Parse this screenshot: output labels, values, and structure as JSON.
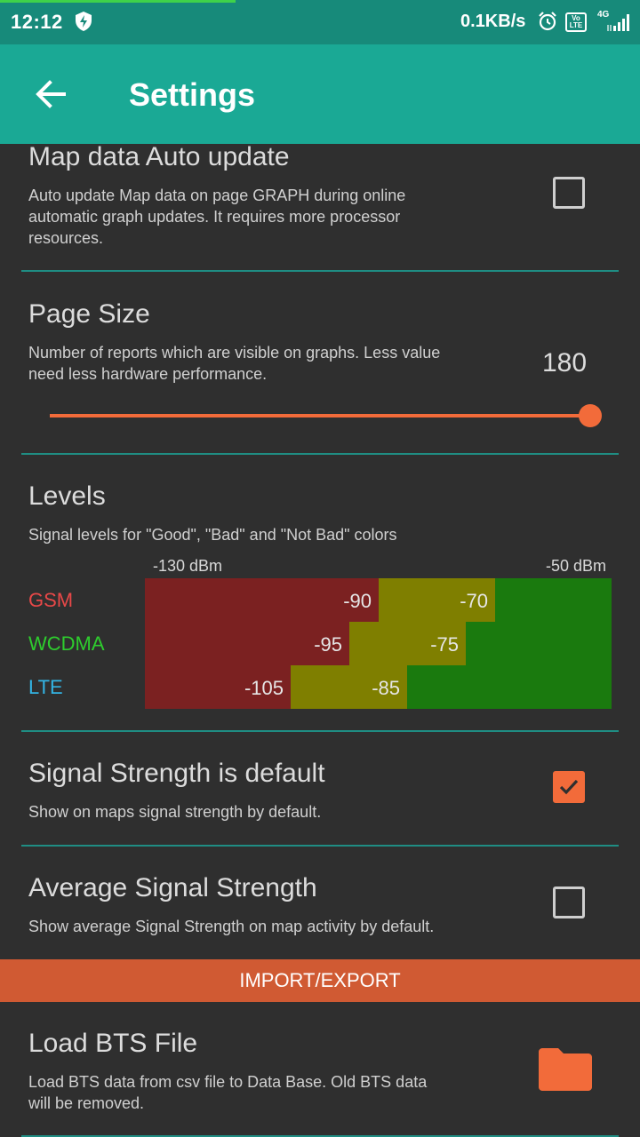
{
  "status_bar": {
    "time": "12:12",
    "net_speed": "0.1KB/s",
    "volte": "Vo LTE",
    "network_type": "4G",
    "icons": [
      "shield-icon",
      "alarm-icon",
      "volte-icon",
      "signal-icon"
    ]
  },
  "app_bar": {
    "title": "Settings",
    "back_icon": "arrow-left-icon"
  },
  "preferences": {
    "map_auto_update": {
      "title": "Map data Auto update",
      "summary_line1": "Auto update Map data on page GRAPH during online",
      "summary_line2": "automatic graph updates. It requires more processor",
      "summary_line3": "resources.",
      "checked": false
    },
    "page_size": {
      "title": "Page Size",
      "summary_line1": "Number of reports which are visible on graphs. Less value",
      "summary_line2": "need less hardware performance.",
      "value": "180",
      "slider_fraction": 1.0
    },
    "levels": {
      "title": "Levels",
      "summary": "Signal levels for \"Good\", \"Bad\" and \"Not Bad\" colors",
      "range_min": "-130 dBm",
      "range_max": "-50 dBm",
      "range_min_value": -130,
      "range_max_value": -50,
      "rows": [
        {
          "tech": "GSM",
          "color": "#e84848",
          "bad": "-90",
          "not_bad": "-70",
          "bad_value": -90,
          "not_bad_value": -70
        },
        {
          "tech": "WCDMA",
          "color": "#2ecc2e",
          "bad": "-95",
          "not_bad": "-75",
          "bad_value": -95,
          "not_bad_value": -75
        },
        {
          "tech": "LTE",
          "color": "#33b5e5",
          "bad": "-105",
          "not_bad": "-85",
          "bad_value": -105,
          "not_bad_value": -85
        }
      ],
      "colors": {
        "bad": "#7b2121",
        "not_bad": "#7f7f00",
        "good": "#1a7a0e"
      }
    },
    "signal_default": {
      "title": "Signal Strength is default",
      "summary": "Show on maps signal strength by default.",
      "checked": true
    },
    "avg_signal": {
      "title": "Average Signal Strength",
      "summary": "Show average Signal Strength on map activity by default.",
      "checked": false
    }
  },
  "section_import_export": {
    "label": "IMPORT/EXPORT",
    "color": "#d05a33"
  },
  "load_bts": {
    "title": "Load BTS File",
    "summary_line1": "Load BTS data from csv file to Data Base. Old BTS data",
    "summary_line2": "will be removed.",
    "icon": "folder-icon"
  },
  "accent_color": "#f26b3a",
  "primary_color": "#1aa995"
}
